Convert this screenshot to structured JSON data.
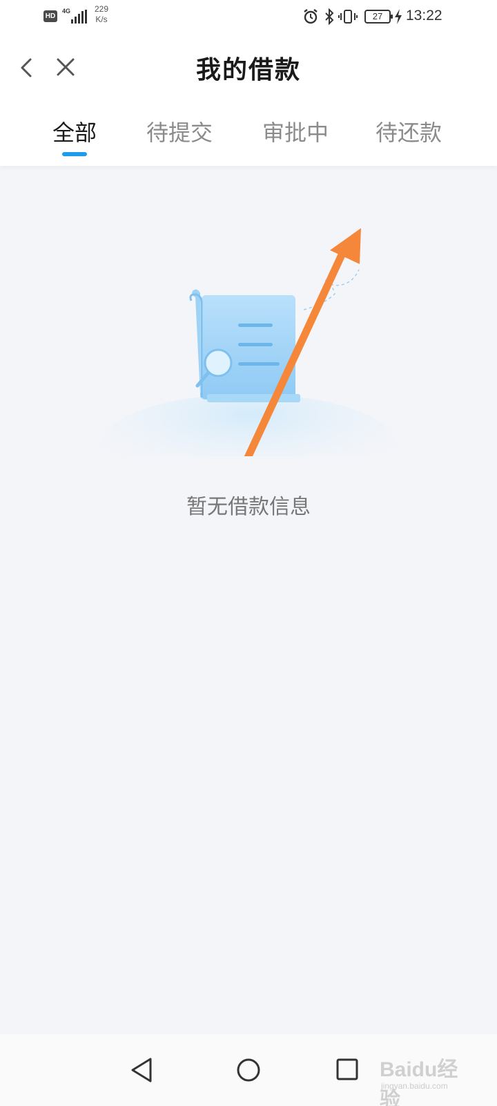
{
  "status_bar": {
    "hd_label": "HD",
    "network_type": "4G",
    "speed_value": "229",
    "speed_unit": "K/s",
    "battery": "27",
    "time": "13:22"
  },
  "header": {
    "title": "我的借款"
  },
  "tabs": [
    {
      "label": "全部",
      "active": true
    },
    {
      "label": "待提交",
      "active": false
    },
    {
      "label": "审批中",
      "active": false
    },
    {
      "label": "待还款",
      "active": false
    }
  ],
  "empty_state": {
    "message": "暂无借款信息"
  },
  "watermark": {
    "text": "Baidu经验",
    "url": "jingyan.baidu.com"
  },
  "colors": {
    "accent": "#1e9bea",
    "annotation_arrow": "#f5873a",
    "background": "#f4f5f9"
  }
}
